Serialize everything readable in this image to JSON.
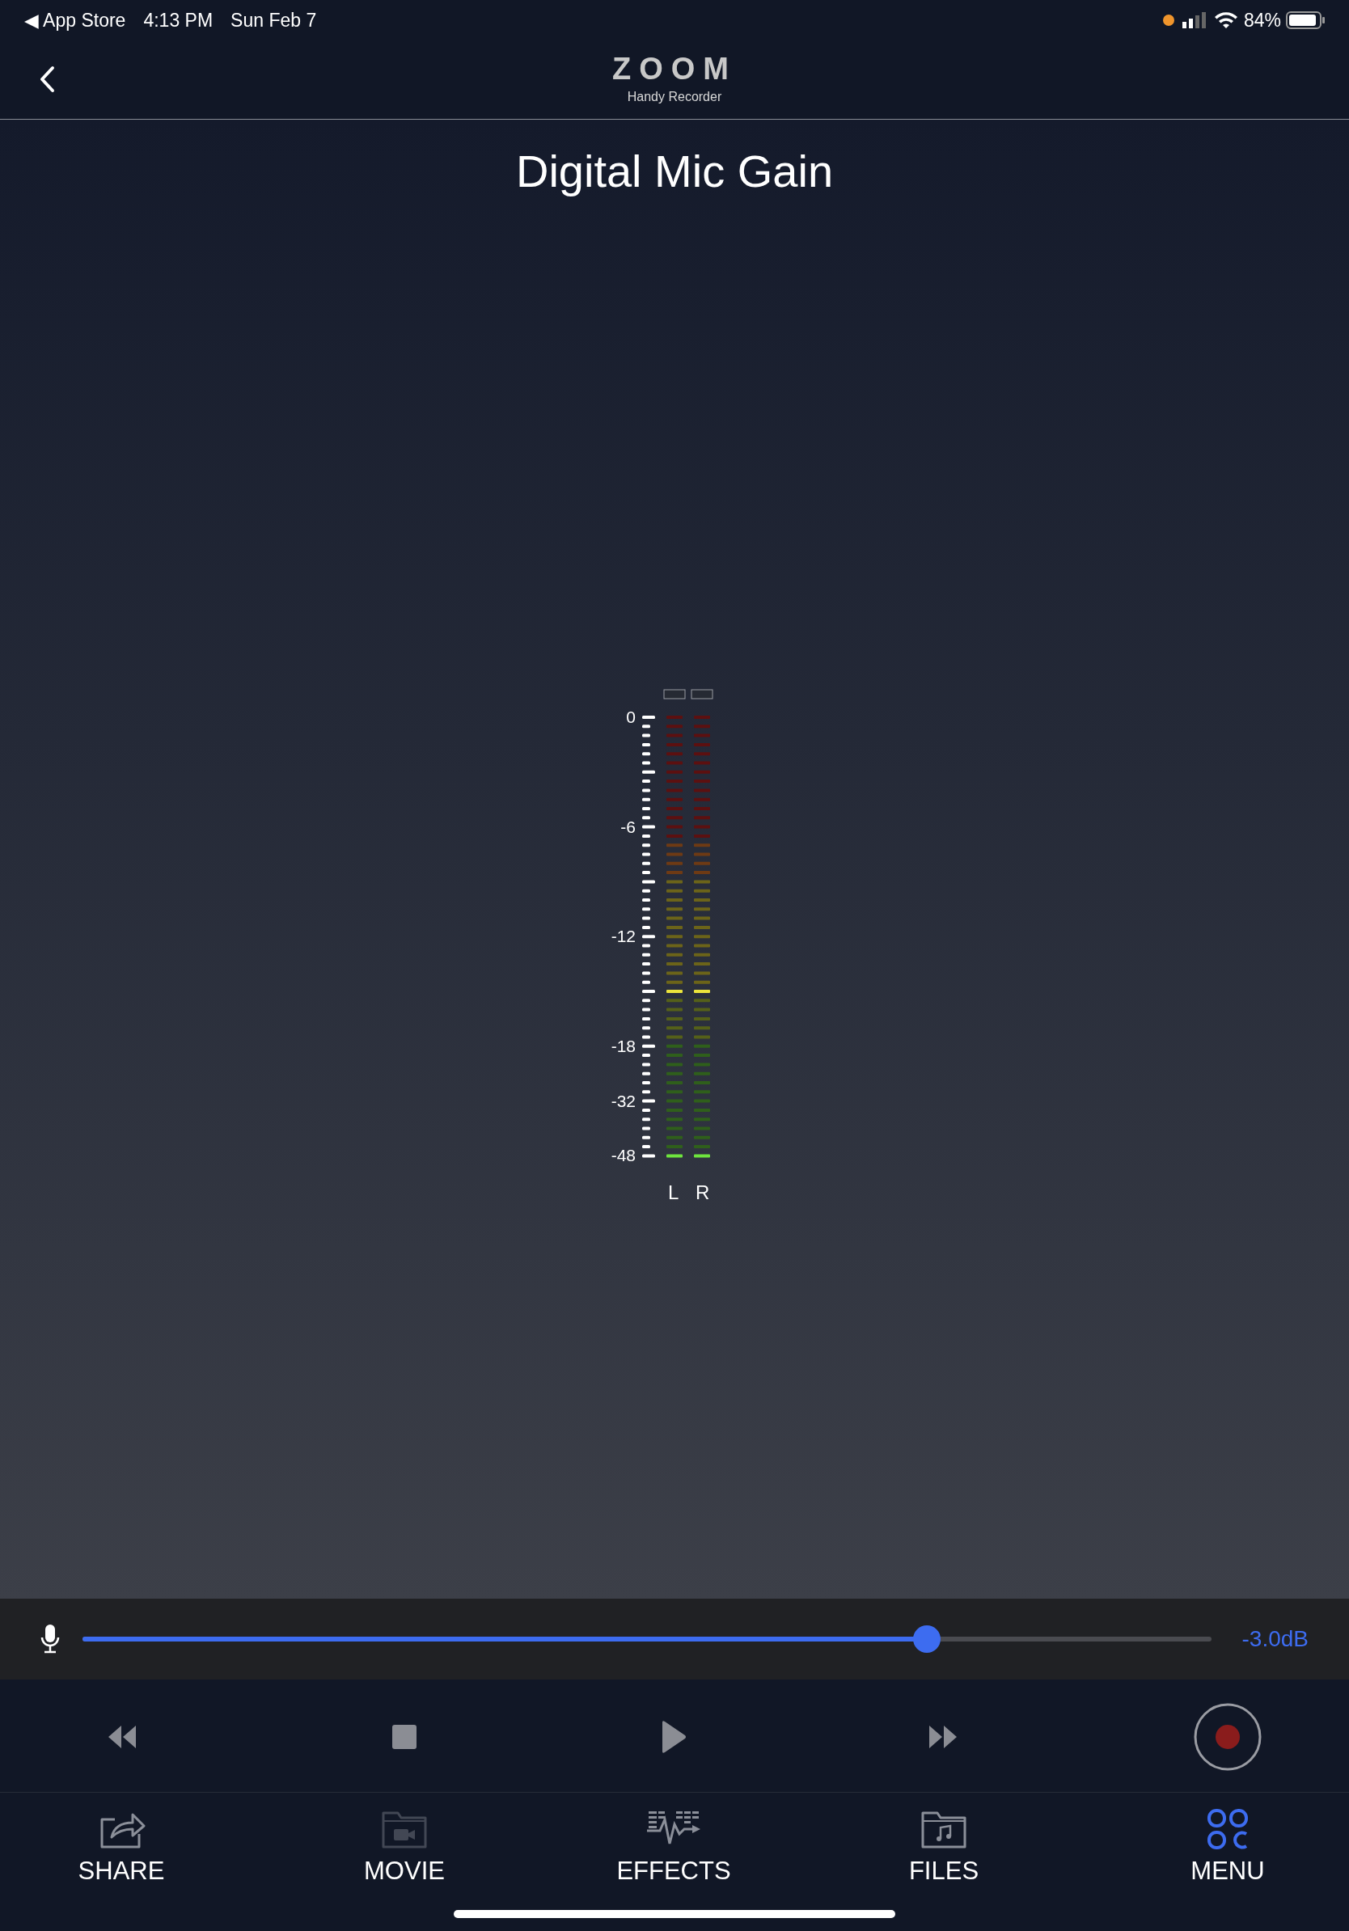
{
  "status_bar": {
    "back_app": "◀ App Store",
    "time": "4:13 PM",
    "date": "Sun Feb 7",
    "battery": "84%"
  },
  "header": {
    "logo": "ZOOM",
    "subtitle": "Handy Recorder"
  },
  "title": "Digital Mic Gain",
  "meter": {
    "scale": [
      "0",
      "-6",
      "-12",
      "-18",
      "-32",
      "-48"
    ],
    "channels": [
      {
        "label": "L",
        "level": 0.375,
        "clip": false
      },
      {
        "label": "R",
        "level": 0.375,
        "clip": false
      }
    ]
  },
  "gain": {
    "level": 0.748,
    "reading": "-3.0dB"
  },
  "transport": [
    {
      "kind": "rewind"
    },
    {
      "kind": "stop"
    },
    {
      "kind": "play"
    },
    {
      "kind": "forward"
    },
    {
      "kind": "record"
    }
  ],
  "tabs": [
    {
      "label": "SHARE",
      "kind": "share",
      "selected": false,
      "disabled": false
    },
    {
      "label": "MOVIE",
      "kind": "movie",
      "selected": false,
      "disabled": true
    },
    {
      "label": "EFFECTS",
      "kind": "effects",
      "selected": false,
      "disabled": false
    },
    {
      "label": "FILES",
      "kind": "files",
      "selected": false,
      "disabled": false
    },
    {
      "label": "MENU",
      "kind": "menu",
      "selected": true,
      "disabled": false
    }
  ]
}
